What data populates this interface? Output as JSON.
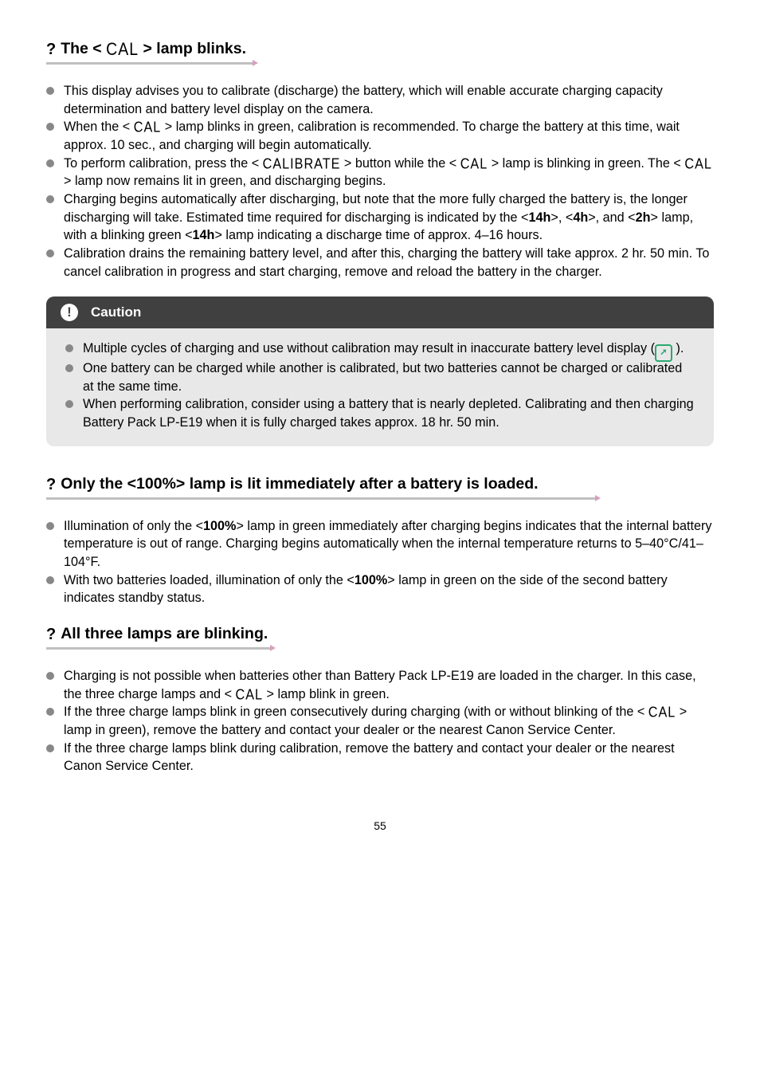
{
  "s1": {
    "heading_pre": "The <",
    "heading_cal": "CAL",
    "heading_post": "> lamp blinks.",
    "b1": "This display advises you to calibrate (discharge) the battery, which will enable accurate charging capacity determination and battery level display on the camera.",
    "b2a": "When the < ",
    "b2b": " > lamp blinks in green, calibration is recommended. To charge the battery at this time, wait approx. 10 sec., and charging will begin automatically.",
    "b3a": "To perform calibration, press the < ",
    "b3_calibrate": "CALIBRATE",
    "b3b": " > button while the < ",
    "b3c": " > lamp is blinking in green. The < ",
    "b3d": " > lamp now remains lit in green, and discharging begins.",
    "b4a": "Charging begins automatically after discharging, but note that the more fully charged the battery is, the longer discharging will take. Estimated time required for discharging is indicated by the <",
    "b4_14h": "14h",
    "b4b": ">, <",
    "b4_4h": "4h",
    "b4c": ">, and <",
    "b4_2h": "2h",
    "b4d": "> lamp, with a blinking green <",
    "b4e": "> lamp indicating a discharge time of approx. 4–16 hours.",
    "b5": "Calibration drains the remaining battery level, and after this, charging the battery will take approx. 2 hr. 50 min. To cancel calibration in progress and start charging, remove and reload the battery in the charger."
  },
  "caution": {
    "title": "Caution",
    "c1a": "Multiple cycles of charging and use without calibration may result in inaccurate battery level display (",
    "c1b": " ).",
    "c2": "One battery can be charged while another is calibrated, but two batteries cannot be charged or calibrated at the same time.",
    "c3": "When performing calibration, consider using a battery that is nearly depleted. Calibrating and then charging Battery Pack LP-E19 when it is fully charged takes approx. 18 hr. 50 min."
  },
  "s2": {
    "heading": "Only the <100%> lamp is lit immediately after a battery is loaded.",
    "b1a": "Illumination of only the <",
    "b1_100": "100%",
    "b1b": "> lamp in green immediately after charging begins indicates that the internal battery temperature is out of range. Charging begins automatically when the internal temperature returns to 5–40°C/41–104°F.",
    "b2a": "With two batteries loaded, illumination of only the <",
    "b2b": "> lamp in green on the side of the second battery indicates standby status."
  },
  "s3": {
    "heading": "All three lamps are blinking.",
    "b1a": "Charging is not possible when batteries other than Battery Pack LP-E19 are loaded in the charger. In this case, the three charge lamps and < ",
    "b1b": " > lamp blink in green.",
    "b2a": "If the three charge lamps blink in green consecutively during charging (with or without blinking of the < ",
    "b2b": " > lamp in green), remove the battery and contact your dealer or the nearest Canon Service Center.",
    "b3": "If the three charge lamps blink during calibration, remove the battery and contact your dealer or the nearest Canon Service Center."
  },
  "page": "55"
}
